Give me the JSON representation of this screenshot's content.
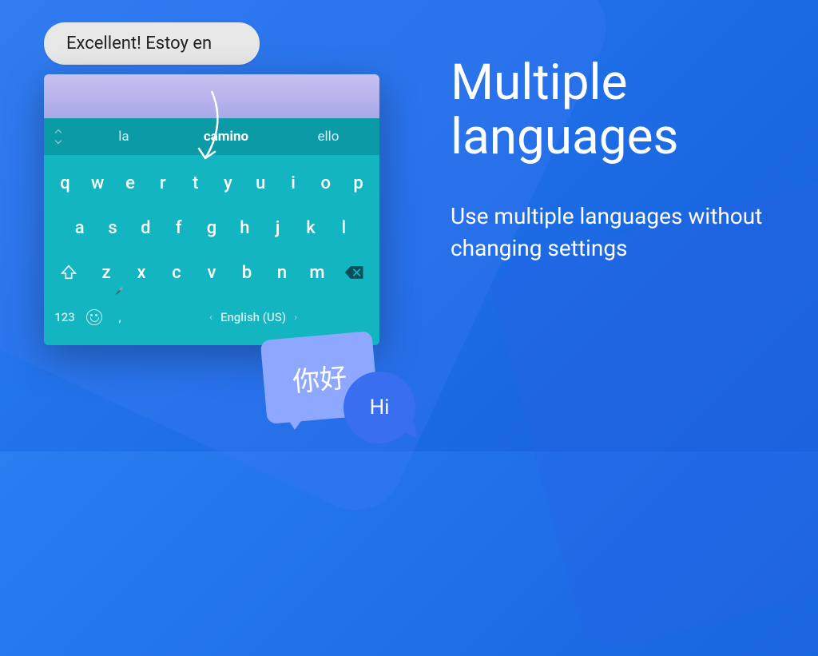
{
  "title_line1": "Multiple",
  "title_line2": "languages",
  "description": "Use multiple languages without changing settings",
  "input_bubble": "Excellent! Estoy en",
  "suggestions": {
    "left": "la",
    "center": "camino",
    "right": "ello"
  },
  "rows": {
    "r1": [
      "q",
      "w",
      "e",
      "r",
      "t",
      "y",
      "u",
      "i",
      "o",
      "p"
    ],
    "r2": [
      "a",
      "s",
      "d",
      "f",
      "g",
      "h",
      "j",
      "k",
      "l"
    ],
    "r3": [
      "z",
      "x",
      "c",
      "v",
      "b",
      "n",
      "m"
    ]
  },
  "bottom": {
    "numbers": "123",
    "comma": ",",
    "language": "English (US)",
    "period": "."
  },
  "chat": {
    "chinese": "你好",
    "english": "Hi"
  }
}
